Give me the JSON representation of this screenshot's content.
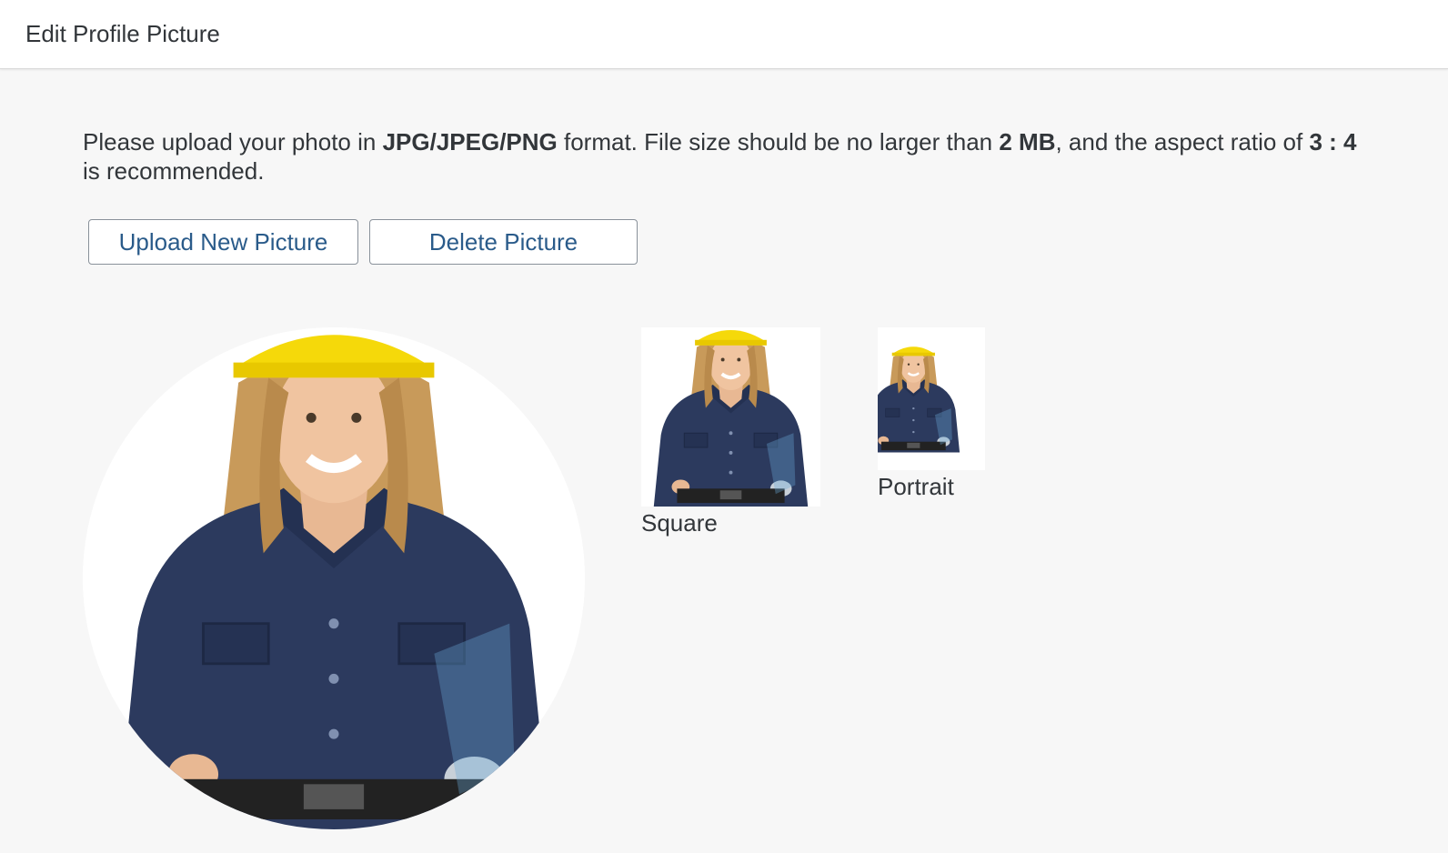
{
  "header": {
    "title": "Edit Profile Picture"
  },
  "instructions": {
    "part1": "Please upload your photo in ",
    "format": "JPG/JPEG/PNG",
    "part2": " format. File size should be no larger than ",
    "size": "2 MB",
    "part3": ", and the aspect ratio of ",
    "ratio": "3 : 4",
    "part4": " is recommended."
  },
  "buttons": {
    "upload_label": "Upload New Picture",
    "delete_label": "Delete Picture"
  },
  "previews": {
    "square_label": "Square",
    "portrait_label": "Portrait"
  },
  "colors": {
    "background": "#f7f7f7",
    "header_bg": "#ffffff",
    "button_text": "#2a5b8a",
    "helmet": "#f5d90a",
    "coverall": "#2c3a5e"
  }
}
